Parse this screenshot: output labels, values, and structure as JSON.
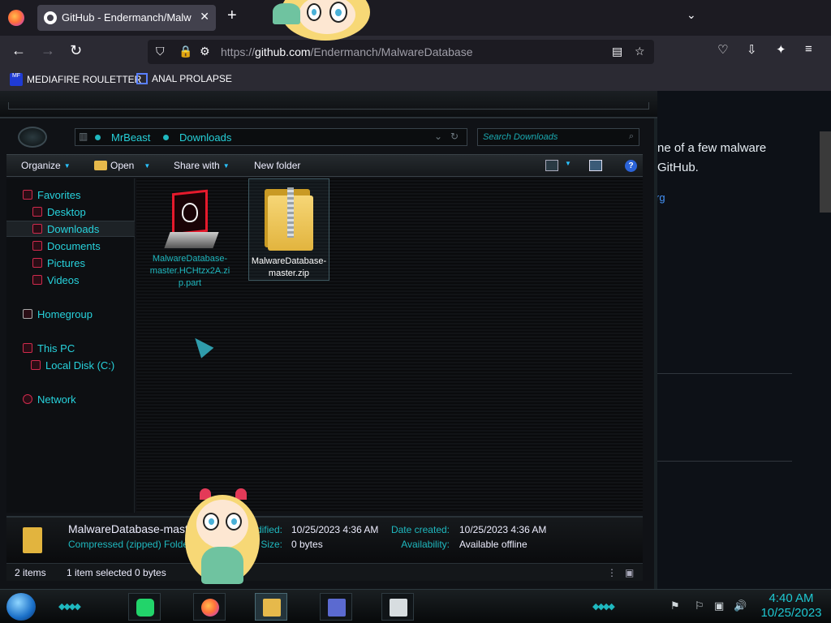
{
  "browser": {
    "tab_title": "GitHub - Endermanch/MalwareDatabase",
    "tab_close": "✕",
    "new_tab": "+",
    "tab_list": "⌄",
    "url_prefix": "https://",
    "url_host": "github.com",
    "url_path": "/Endermanch/MalwareDatabase",
    "bookmarks": [
      {
        "label": "MEDIAFIRE ROULETTER",
        "icon": "MF"
      },
      {
        "label": "ANAL PROLAPSE",
        "icon": ""
      }
    ]
  },
  "github": {
    "desc_line1": "ne of a few malware",
    "desc_line2": "GitHub.",
    "link": "rg"
  },
  "explorer": {
    "breadcrumb": [
      "MrBeast",
      "Downloads"
    ],
    "search_placeholder": "Search Downloads",
    "toolbar": {
      "organize": "Organize",
      "open": "Open",
      "share_with": "Share with",
      "new_folder": "New folder",
      "help": "?"
    },
    "nav": {
      "favorites": "Favorites",
      "desktop": "Desktop",
      "downloads": "Downloads",
      "documents": "Documents",
      "pictures": "Pictures",
      "videos": "Videos",
      "homegroup": "Homegroup",
      "this_pc": "This PC",
      "local_disk": "Local Disk (C:)",
      "network": "Network"
    },
    "files": [
      {
        "name": "MalwareDatabase-master.HCHtzx2A.zip.part",
        "color": "#1fb8bf"
      },
      {
        "name": "MalwareDatabase-master.zip",
        "color": "#ffffff"
      }
    ],
    "details": {
      "name": "MalwareDatabase-mast",
      "type": "Compressed (zipped) Folde",
      "date_modified_label": "odified:",
      "date_modified": "10/25/2023 4:36 AM",
      "size_label": "Size:",
      "size": "0 bytes",
      "date_created_label": "Date created:",
      "date_created": "10/25/2023 4:36 AM",
      "availability_label": "Availability:",
      "availability": "Available offline"
    },
    "status": {
      "items": "2 items",
      "selected": "1 item selected  0 bytes"
    }
  },
  "taskbar": {
    "time": "4:40 AM",
    "date": "10/25/2023"
  },
  "colors": {
    "accent": "#1fb8bf",
    "selection": "#1d2226"
  }
}
